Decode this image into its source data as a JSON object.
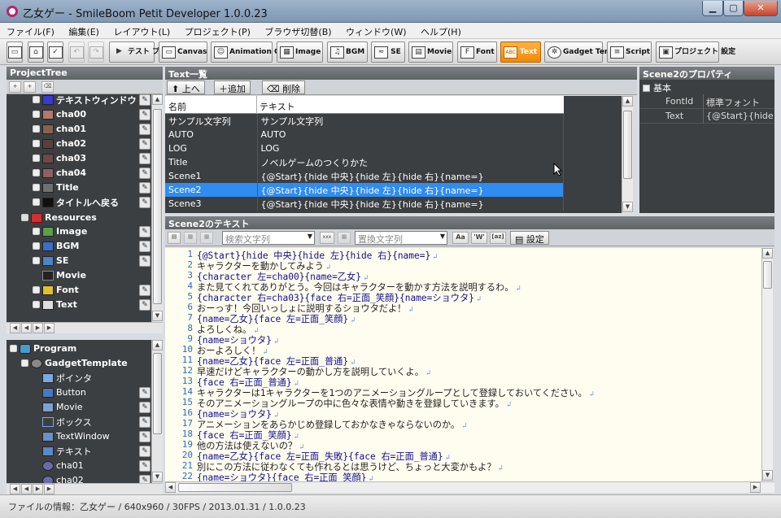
{
  "window": {
    "title": "乙女ゲー - SmileBoom Petit Developer 1.0.0.23",
    "minimize": "▁",
    "restore": "▢",
    "close": "✕"
  },
  "menu": [
    "ファイル(F)",
    "編集(E)",
    "レイアウト(L)",
    "プロジェクト(P)",
    "ブラウザ切替(B)",
    "ウィンドウ(W)",
    "ヘルプ(H)"
  ],
  "toolbar": {
    "test_play": "テスト プレイ",
    "canvas": "Canvas",
    "animation_group": "Animation Group",
    "image": "Image",
    "bgm": "BGM",
    "se": "SE",
    "movie": "Movie",
    "font": "Font",
    "text": "Text",
    "gadget_template": "Gadget Template",
    "script": "Script",
    "project_settings": "プロジェクト 設定",
    "text_icon": "ABC"
  },
  "project_tree": {
    "title": "ProjectTree",
    "items": [
      {
        "label": "テキストウィンドウ",
        "icon_color": "#3a3ad0"
      },
      {
        "label": "cha00",
        "icon_color": "#b07a70"
      },
      {
        "label": "cha01",
        "icon_color": "#8a6050"
      },
      {
        "label": "cha02",
        "icon_color": "#5a4038"
      },
      {
        "label": "cha03",
        "icon_color": "#704848"
      },
      {
        "label": "cha04",
        "icon_color": "#906060"
      },
      {
        "label": "Title",
        "icon_color": "#707070"
      },
      {
        "label": "タイトルへ戻る",
        "icon_color": "#101010"
      }
    ],
    "resources_label": "Resources",
    "resources": [
      {
        "label": "Image",
        "icon": "image-icon"
      },
      {
        "label": "BGM",
        "icon": "music-note-icon"
      },
      {
        "label": "SE",
        "icon": "wave-icon"
      },
      {
        "label": "Movie",
        "icon": "film-icon"
      },
      {
        "label": "Font",
        "icon": "font-icon"
      },
      {
        "label": "Text",
        "icon": "text-icon"
      }
    ]
  },
  "program_tree": {
    "program_label": "Program",
    "gadget_template_label": "GadgetTemplate",
    "items": [
      "ポインタ",
      "Button",
      "Movie",
      "ボックス",
      "TextWindow",
      "テキスト",
      "cha01",
      "cha02"
    ]
  },
  "text_list": {
    "title": "Text一覧",
    "up_button": "上へ",
    "add_button": "追加",
    "delete_button": "削除",
    "columns": [
      "名前",
      "テキスト"
    ],
    "rows": [
      {
        "name": "サンプル文字列",
        "text": "サンプル文字列"
      },
      {
        "name": "AUTO",
        "text": "AUTO"
      },
      {
        "name": "LOG",
        "text": "LOG"
      },
      {
        "name": "Title",
        "text": "ノベルゲームのつくりかた"
      },
      {
        "name": "Scene1",
        "text": "{@Start}{hide 中央}{hide 左}{hide 右}{name=}"
      },
      {
        "name": "Scene2",
        "text": "{@Start}{hide 中央}{hide 左}{hide 右}{name=}"
      },
      {
        "name": "Scene3",
        "text": "{@Start}{hide 中央}{hide 左}{hide 右}{name=}"
      }
    ],
    "selected_index": 5
  },
  "properties": {
    "title": "Scene2のプロパティ",
    "group": "基本",
    "rows": [
      {
        "key": "FontId",
        "value": "標準フォント"
      },
      {
        "key": "Text",
        "value": "{@Start}{hide"
      }
    ]
  },
  "editor": {
    "title": "Scene2のテキスト",
    "search_placeholder": "検索文字列",
    "replace_placeholder": "置換文字列",
    "opt_case": "Aa",
    "opt_word": "'W'",
    "opt_regex": "[az]",
    "opt_xxx": "xxx",
    "settings_button": "設定",
    "lines": [
      "{@Start}{hide 中央}{hide 左}{hide 右}{name=}",
      "キャラクターを動かしてみよう",
      "{character 左=cha00}{name=乙女}",
      "また見てくれてありがとう。今回はキャラクターを動かす方法を説明するわ。",
      "{character 右=cha03}{face 右=正面_笑顔}{name=ショウタ}",
      "おーっす！今回いっしょに説明するショウタだよ！",
      "{name=乙女}{face 左=正面_笑顔}",
      "よろしくね。",
      "{name=ショウタ}",
      "おーよろしく！",
      "{name=乙女}{face 左=正面_普通}",
      "早速だけどキャラクターの動かし方を説明していくよ。",
      "{face 右=正面_普通}",
      "キャラクターは1キャラクターを1つのアニメーショングループとして登録しておいてください。",
      "そのアニメーショングループの中に色々な表情や動きを登録していきます。",
      "{name=ショウタ}",
      "アニメーションをあらかじめ登録しておかなきゃならないのか。",
      "{face 右=正面_笑顔}",
      "他の方法は使えないの？",
      "{name=乙女}{face 左=正面_失敗}{face 右=正面_普通}",
      "別にこの方法に従わなくても作れるとは思うけど、ちょっと大変かもよ？",
      "{name=ショウタ}{face 右=正面_笑顔}"
    ],
    "line_numbers": [
      "1",
      "2",
      "3",
      "4",
      "5",
      "6",
      "7",
      "8",
      "9",
      "10",
      "11",
      "12",
      "13",
      "14",
      "15",
      "16",
      "17",
      "18",
      "19",
      "20",
      "21",
      "22"
    ],
    "return_mark": "↲"
  },
  "status": {
    "text": "ファイルの情報：乙女ゲー / 640x960 / 30FPS / 2013.01.31 / 1.0.0.23"
  },
  "colors": {
    "selection": "#2f8cf0",
    "active_tool": "#f08a00",
    "panel_dark": "#3c3f42",
    "editor_bg": "#fffcf0"
  }
}
